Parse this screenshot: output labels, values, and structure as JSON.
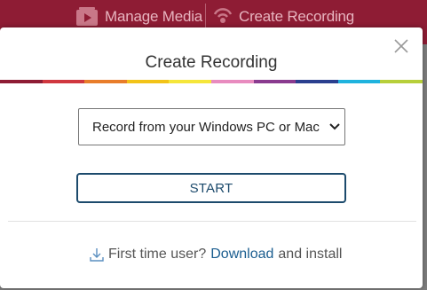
{
  "background": {
    "nav_media_label": "Manage Media",
    "nav_recording_label": "Create Recording",
    "header_color": "#8e1c34"
  },
  "modal": {
    "title": "Create Recording",
    "close_icon": "close-icon",
    "color_bar": [
      "#8e1c34",
      "#d0373f",
      "#e87d2a",
      "#f2c318",
      "#f5e63a",
      "#e88bbf",
      "#8a3b8f",
      "#2a3f8f",
      "#1fb3de",
      "#b7cf3a"
    ],
    "select": {
      "value": "Record from your Windows PC or Mac",
      "options": [
        "Record from your Windows PC or Mac"
      ]
    },
    "start_label": "START",
    "footer": {
      "prefix": "First time user?",
      "link_label": "Download",
      "suffix": "and install",
      "icon": "download-icon"
    }
  }
}
